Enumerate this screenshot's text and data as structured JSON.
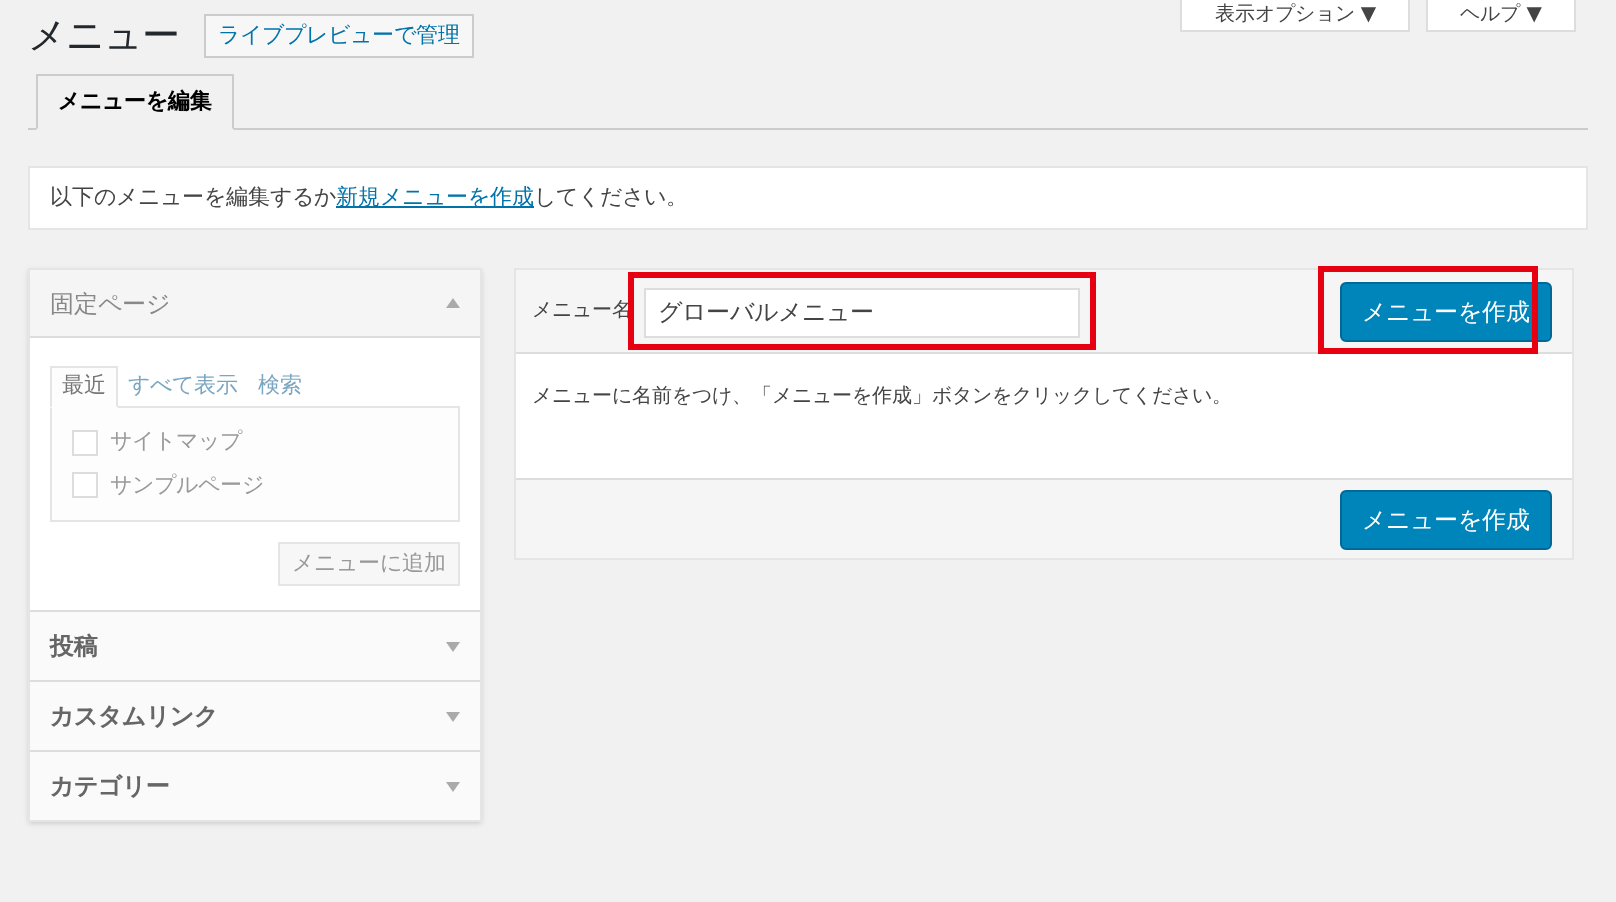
{
  "header": {
    "title": "メニュー",
    "manage_button": "ライブプレビューで管理",
    "screen_options": "表示オプション ▼",
    "help": "ヘルプ ▼"
  },
  "tabs": [
    {
      "label": "メニューを編集",
      "selected": true
    }
  ],
  "notice": {
    "before": "以下のメニューを編集するか",
    "link": "新規メニューを作成",
    "after": "してください。"
  },
  "sidebar": {
    "sections": [
      {
        "title": "固定ページ",
        "expanded": true,
        "tabs": [
          {
            "label": "最近",
            "selected": true
          },
          {
            "label": "すべて表示",
            "selected": false
          },
          {
            "label": "検索",
            "selected": false
          }
        ],
        "items": [
          {
            "label": "サイトマップ",
            "checked": false
          },
          {
            "label": "サンプルページ",
            "checked": false
          }
        ],
        "add_button": {
          "label": "メニューに追加",
          "disabled": true
        }
      },
      {
        "title": "投稿",
        "expanded": false
      },
      {
        "title": "カスタムリンク",
        "expanded": false
      },
      {
        "title": "カテゴリー",
        "expanded": false
      }
    ]
  },
  "editor": {
    "name_label": "メニュー名",
    "name_value": "グローバルメニュー",
    "create_button_top": "メニューを作成",
    "instructions": "メニューに名前をつけ、「メニューを作成」ボタンをクリックしてください。",
    "create_button_bottom": "メニューを作成"
  }
}
